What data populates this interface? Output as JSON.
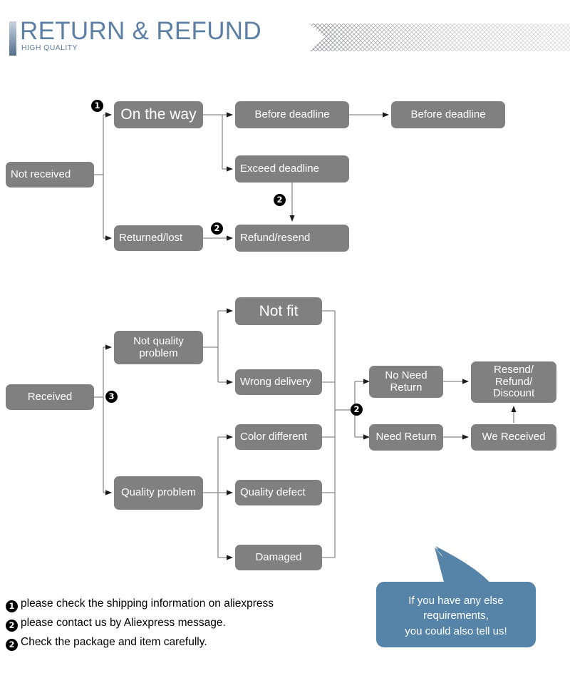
{
  "header": {
    "title": "RETURN & REFUND",
    "subtitle": "HIGH QUALITY",
    "accent_color": "#5c7fa4",
    "ribbon_pattern": "diagonal-crosshatch"
  },
  "palette": {
    "box_gray": "#808080",
    "box_text": "#ffffff",
    "bubble_blue": "#5683a8",
    "title_blue": "#5c7fa4",
    "line_gray": "#808080",
    "badge_black": "#000000"
  },
  "flow_not_received": {
    "root": "Not received",
    "boxes": [
      {
        "id": "on-the-way",
        "label": "On the way"
      },
      {
        "id": "returned-lost",
        "label": "Returned/lost"
      },
      {
        "id": "before-deadline-1",
        "label": "Before deadline"
      },
      {
        "id": "exceed-deadline",
        "label": "Exceed deadline"
      },
      {
        "id": "before-deadline-2",
        "label": "Before deadline"
      },
      {
        "id": "refund-resend",
        "label": "Refund/resend"
      }
    ],
    "badges": [
      {
        "id": "badge-not-received-split",
        "value": "1"
      },
      {
        "id": "badge-exceed-to-refund",
        "value": "2"
      },
      {
        "id": "badge-returned-to-refund",
        "value": "2"
      }
    ]
  },
  "flow_received": {
    "root": "Received",
    "boxes": [
      {
        "id": "not-quality-problem",
        "label": "Not quality\nproblem"
      },
      {
        "id": "quality-problem",
        "label": "Quality problem"
      },
      {
        "id": "not-fit",
        "label": "Not fit"
      },
      {
        "id": "wrong-delivery",
        "label": "Wrong delivery"
      },
      {
        "id": "color-different",
        "label": "Color different"
      },
      {
        "id": "quality-defect",
        "label": "Quality defect"
      },
      {
        "id": "damaged",
        "label": "Damaged"
      },
      {
        "id": "no-need-return",
        "label": "No Need\nReturn"
      },
      {
        "id": "need-return",
        "label": "Need Return"
      },
      {
        "id": "we-received",
        "label": "We Received"
      },
      {
        "id": "resend-refund-discount",
        "label": "Resend/\nRefund/\nDiscount"
      }
    ],
    "badges": [
      {
        "id": "badge-received-split",
        "value": "3"
      },
      {
        "id": "badge-return-split",
        "value": "2"
      }
    ]
  },
  "bubble": {
    "lines": [
      "If you have any else",
      "requirements,",
      "you could also tell us!"
    ]
  },
  "notes": [
    {
      "badge": "1",
      "text": "please check the shipping information on aliexpress"
    },
    {
      "badge": "2",
      "text": "please contact us by Aliexpress message."
    },
    {
      "badge": "2",
      "text": "Check the package and item carefully."
    }
  ]
}
